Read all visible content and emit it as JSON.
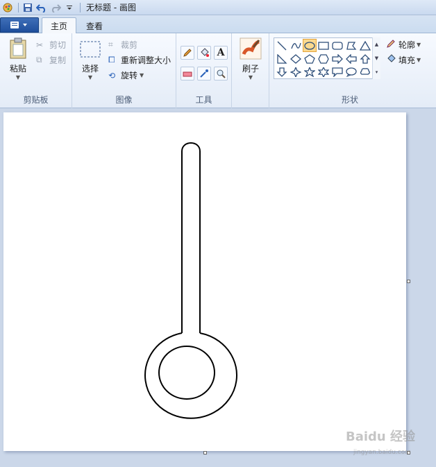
{
  "window": {
    "title": "无标题 - 画图"
  },
  "tabs": [
    {
      "label": "主页",
      "active": true
    },
    {
      "label": "查看",
      "active": false
    }
  ],
  "clipboard": {
    "paste": "粘贴",
    "cut": "剪切",
    "copy": "复制",
    "group": "剪贴板"
  },
  "image": {
    "select": "选择",
    "crop": "裁剪",
    "resize": "重新调整大小",
    "rotate": "旋转",
    "group": "图像"
  },
  "tools": {
    "group": "工具"
  },
  "brushes": {
    "label": "刷子"
  },
  "shapes": {
    "group": "形状",
    "outline": "轮廓",
    "fill": "填充"
  },
  "colors": {
    "accent": "#1f4f9c",
    "selected": "#fbd98f"
  },
  "watermark": {
    "main": "Baidu 经验",
    "sub": "jingyan.baidu.com"
  }
}
